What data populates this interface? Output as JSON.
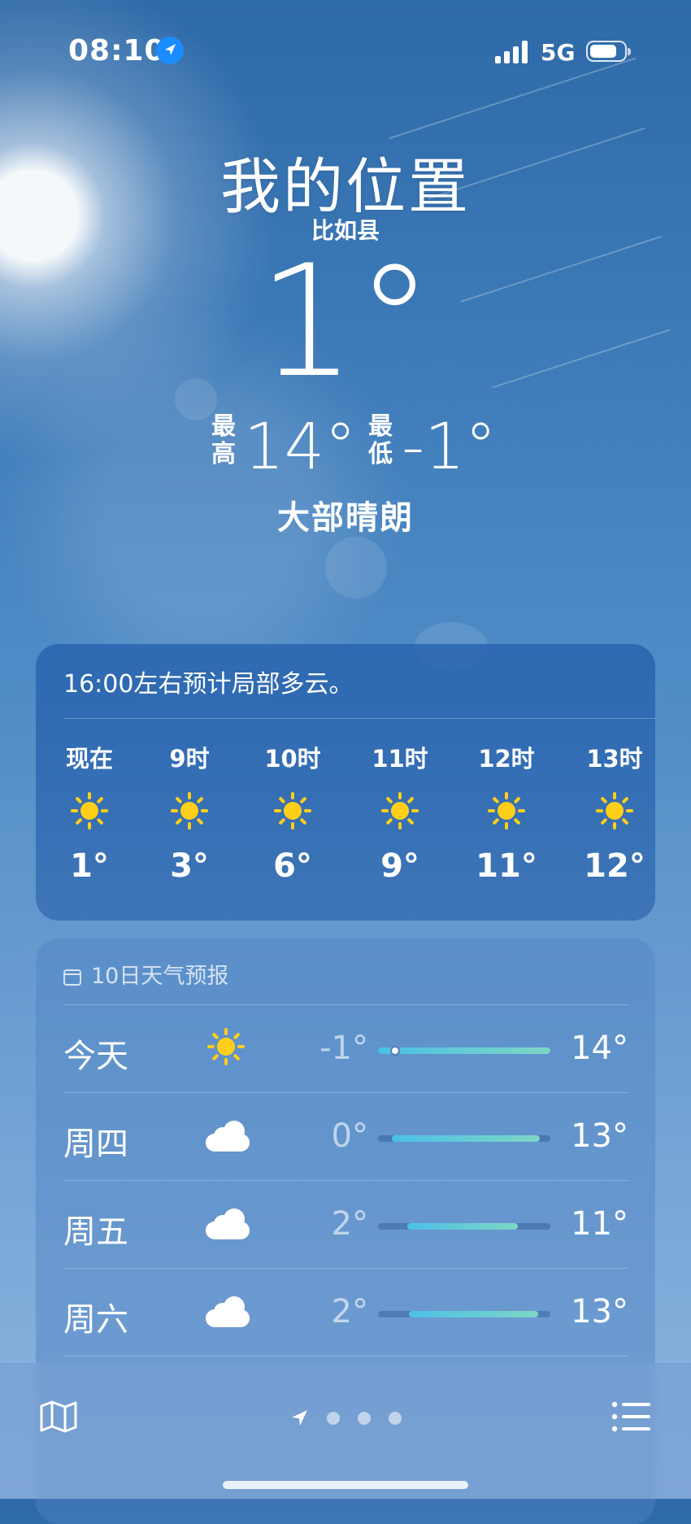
{
  "status_bar": {
    "time": "08:10",
    "network": "5G",
    "icons": [
      "location-arrow-icon",
      "cellular-signal-icon",
      "battery-icon"
    ]
  },
  "location": {
    "title": "我的位置",
    "subtitle": "比如县"
  },
  "current": {
    "temperature": "1°",
    "high_label": "最高",
    "high": "14°",
    "low_label": "最低",
    "low": "-1°",
    "condition": "大部晴朗"
  },
  "hourly": {
    "summary": "16:00左右预计局部多云。",
    "items": [
      {
        "label": "现在",
        "icon": "sun-icon",
        "temp": "1°"
      },
      {
        "label": "9时",
        "icon": "sun-icon",
        "temp": "3°"
      },
      {
        "label": "10时",
        "icon": "sun-icon",
        "temp": "6°"
      },
      {
        "label": "11时",
        "icon": "sun-icon",
        "temp": "9°"
      },
      {
        "label": "12时",
        "icon": "sun-icon",
        "temp": "11°"
      },
      {
        "label": "13时",
        "icon": "sun-icon",
        "temp": "12°"
      }
    ]
  },
  "forecast": {
    "title": "10日天气预报",
    "icon": "calendar-icon",
    "days": [
      {
        "day": "今天",
        "icon": "sun-icon",
        "low": "-1°",
        "high": "14°",
        "range_start": 0.0,
        "range_end": 1.0,
        "current_marker": 0.1
      },
      {
        "day": "周四",
        "icon": "cloud-icon",
        "low": "0°",
        "high": "13°",
        "range_start": 0.08,
        "range_end": 0.94
      },
      {
        "day": "周五",
        "icon": "cloud-icon",
        "low": "2°",
        "high": "11°",
        "range_start": 0.17,
        "range_end": 0.81
      },
      {
        "day": "周六",
        "icon": "cloud-icon",
        "low": "2°",
        "high": "13°",
        "range_start": 0.18,
        "range_end": 0.93
      }
    ]
  },
  "toolbar": {
    "left_icon": "map-icon",
    "right_icon": "list-icon",
    "page_count": 4,
    "current_page": "location-arrow-icon"
  },
  "colors": {
    "sun": "#ffcf1a",
    "location_badge": "#1a8cff",
    "temp_bar_start": "#4cc0e8",
    "temp_bar_end": "#7dd6c4"
  }
}
